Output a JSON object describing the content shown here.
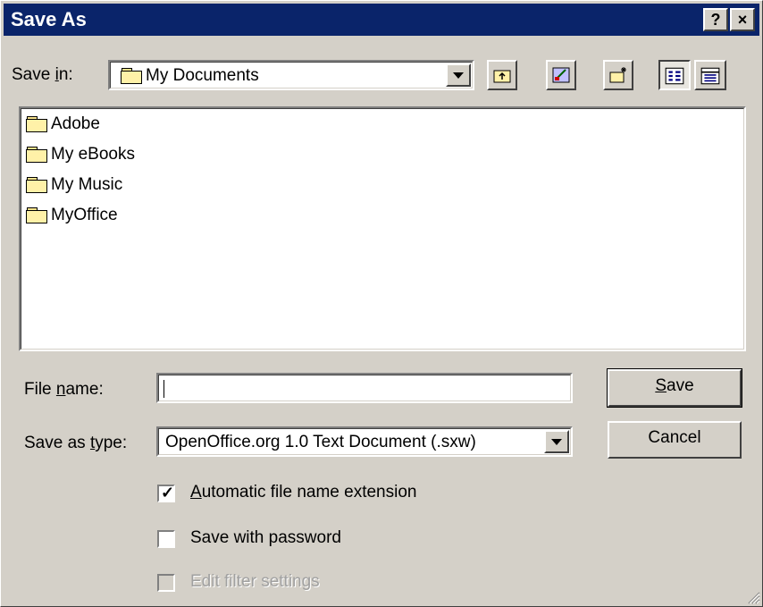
{
  "window": {
    "title": "Save As",
    "help_label": "?",
    "close_label": "×"
  },
  "location": {
    "label_prefix": "Save ",
    "label_key": "i",
    "label_suffix": "n:",
    "current": "My Documents"
  },
  "toolbar": [
    {
      "name": "up-one-level-icon"
    },
    {
      "name": "desktop-icon"
    },
    {
      "name": "new-folder-icon"
    },
    {
      "name": "list-view-icon"
    },
    {
      "name": "details-view-icon"
    }
  ],
  "files": [
    {
      "name": "Adobe",
      "icon": "folder-icon"
    },
    {
      "name": "My eBooks",
      "icon": "folder-icon"
    },
    {
      "name": "My Music",
      "icon": "folder-icon"
    },
    {
      "name": "MyOffice",
      "icon": "folder-icon"
    }
  ],
  "filename": {
    "label_prefix": "File ",
    "label_key": "n",
    "label_suffix": "ame:",
    "value": ""
  },
  "filetype": {
    "label_prefix": "Save as ",
    "label_key": "t",
    "label_suffix": "ype:",
    "value": "OpenOffice.org 1.0 Text Document (.sxw)"
  },
  "buttons": {
    "save_key": "S",
    "save_rest": "ave",
    "cancel": "Cancel"
  },
  "options": {
    "auto_ext": {
      "key": "A",
      "rest": "utomatic file name extension",
      "checked": true
    },
    "password": {
      "label": "Save with password",
      "checked": false
    },
    "filter": {
      "label": "Edit filter settings",
      "checked": false,
      "disabled": true
    }
  },
  "colors": {
    "titlebar": "#0a246a",
    "face": "#d4d0c8",
    "disabled_text": "#a0a0a0"
  }
}
